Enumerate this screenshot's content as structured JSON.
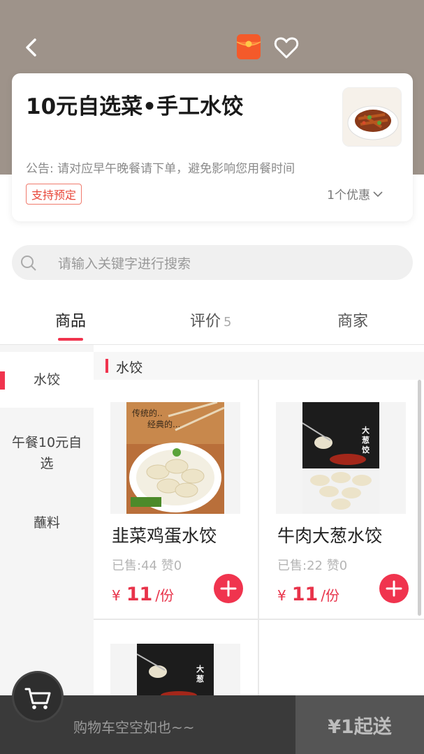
{
  "header": {
    "back_icon": "back-arrow-icon",
    "redpacket_icon": "red-packet-icon",
    "favorite_icon": "heart-icon",
    "bg_color": "#9e938a"
  },
  "shop": {
    "name": "10元自选菜•手工水饺",
    "notice": "公告: 请对应早午晚餐请下单，避免影响您用餐时间",
    "preorder_tag": "支持预定",
    "promo_text": "1个优惠"
  },
  "search": {
    "placeholder": "请输入关键字进行搜索"
  },
  "tabs": [
    {
      "label": "商品",
      "active": true
    },
    {
      "label": "评价",
      "count": "5"
    },
    {
      "label": "商家"
    }
  ],
  "categories": [
    {
      "label": "水饺",
      "active": true
    },
    {
      "label": "午餐10元自选"
    },
    {
      "label": "蘸料"
    }
  ],
  "section": {
    "title": "水饺"
  },
  "products": [
    {
      "name": "韭菜鸡蛋水饺",
      "sales": "已售:44  赞0",
      "yen": "¥",
      "price": "11",
      "unit": "/份"
    },
    {
      "name": "牛肉大葱水饺",
      "sales": "已售:22  赞0",
      "yen": "¥",
      "price": "11",
      "unit": "/份"
    }
  ],
  "cart": {
    "empty_text": "购物车空空如也~~",
    "min_order": "¥1起送"
  },
  "colors": {
    "accent": "#f0344e",
    "price": "#e8334a"
  }
}
